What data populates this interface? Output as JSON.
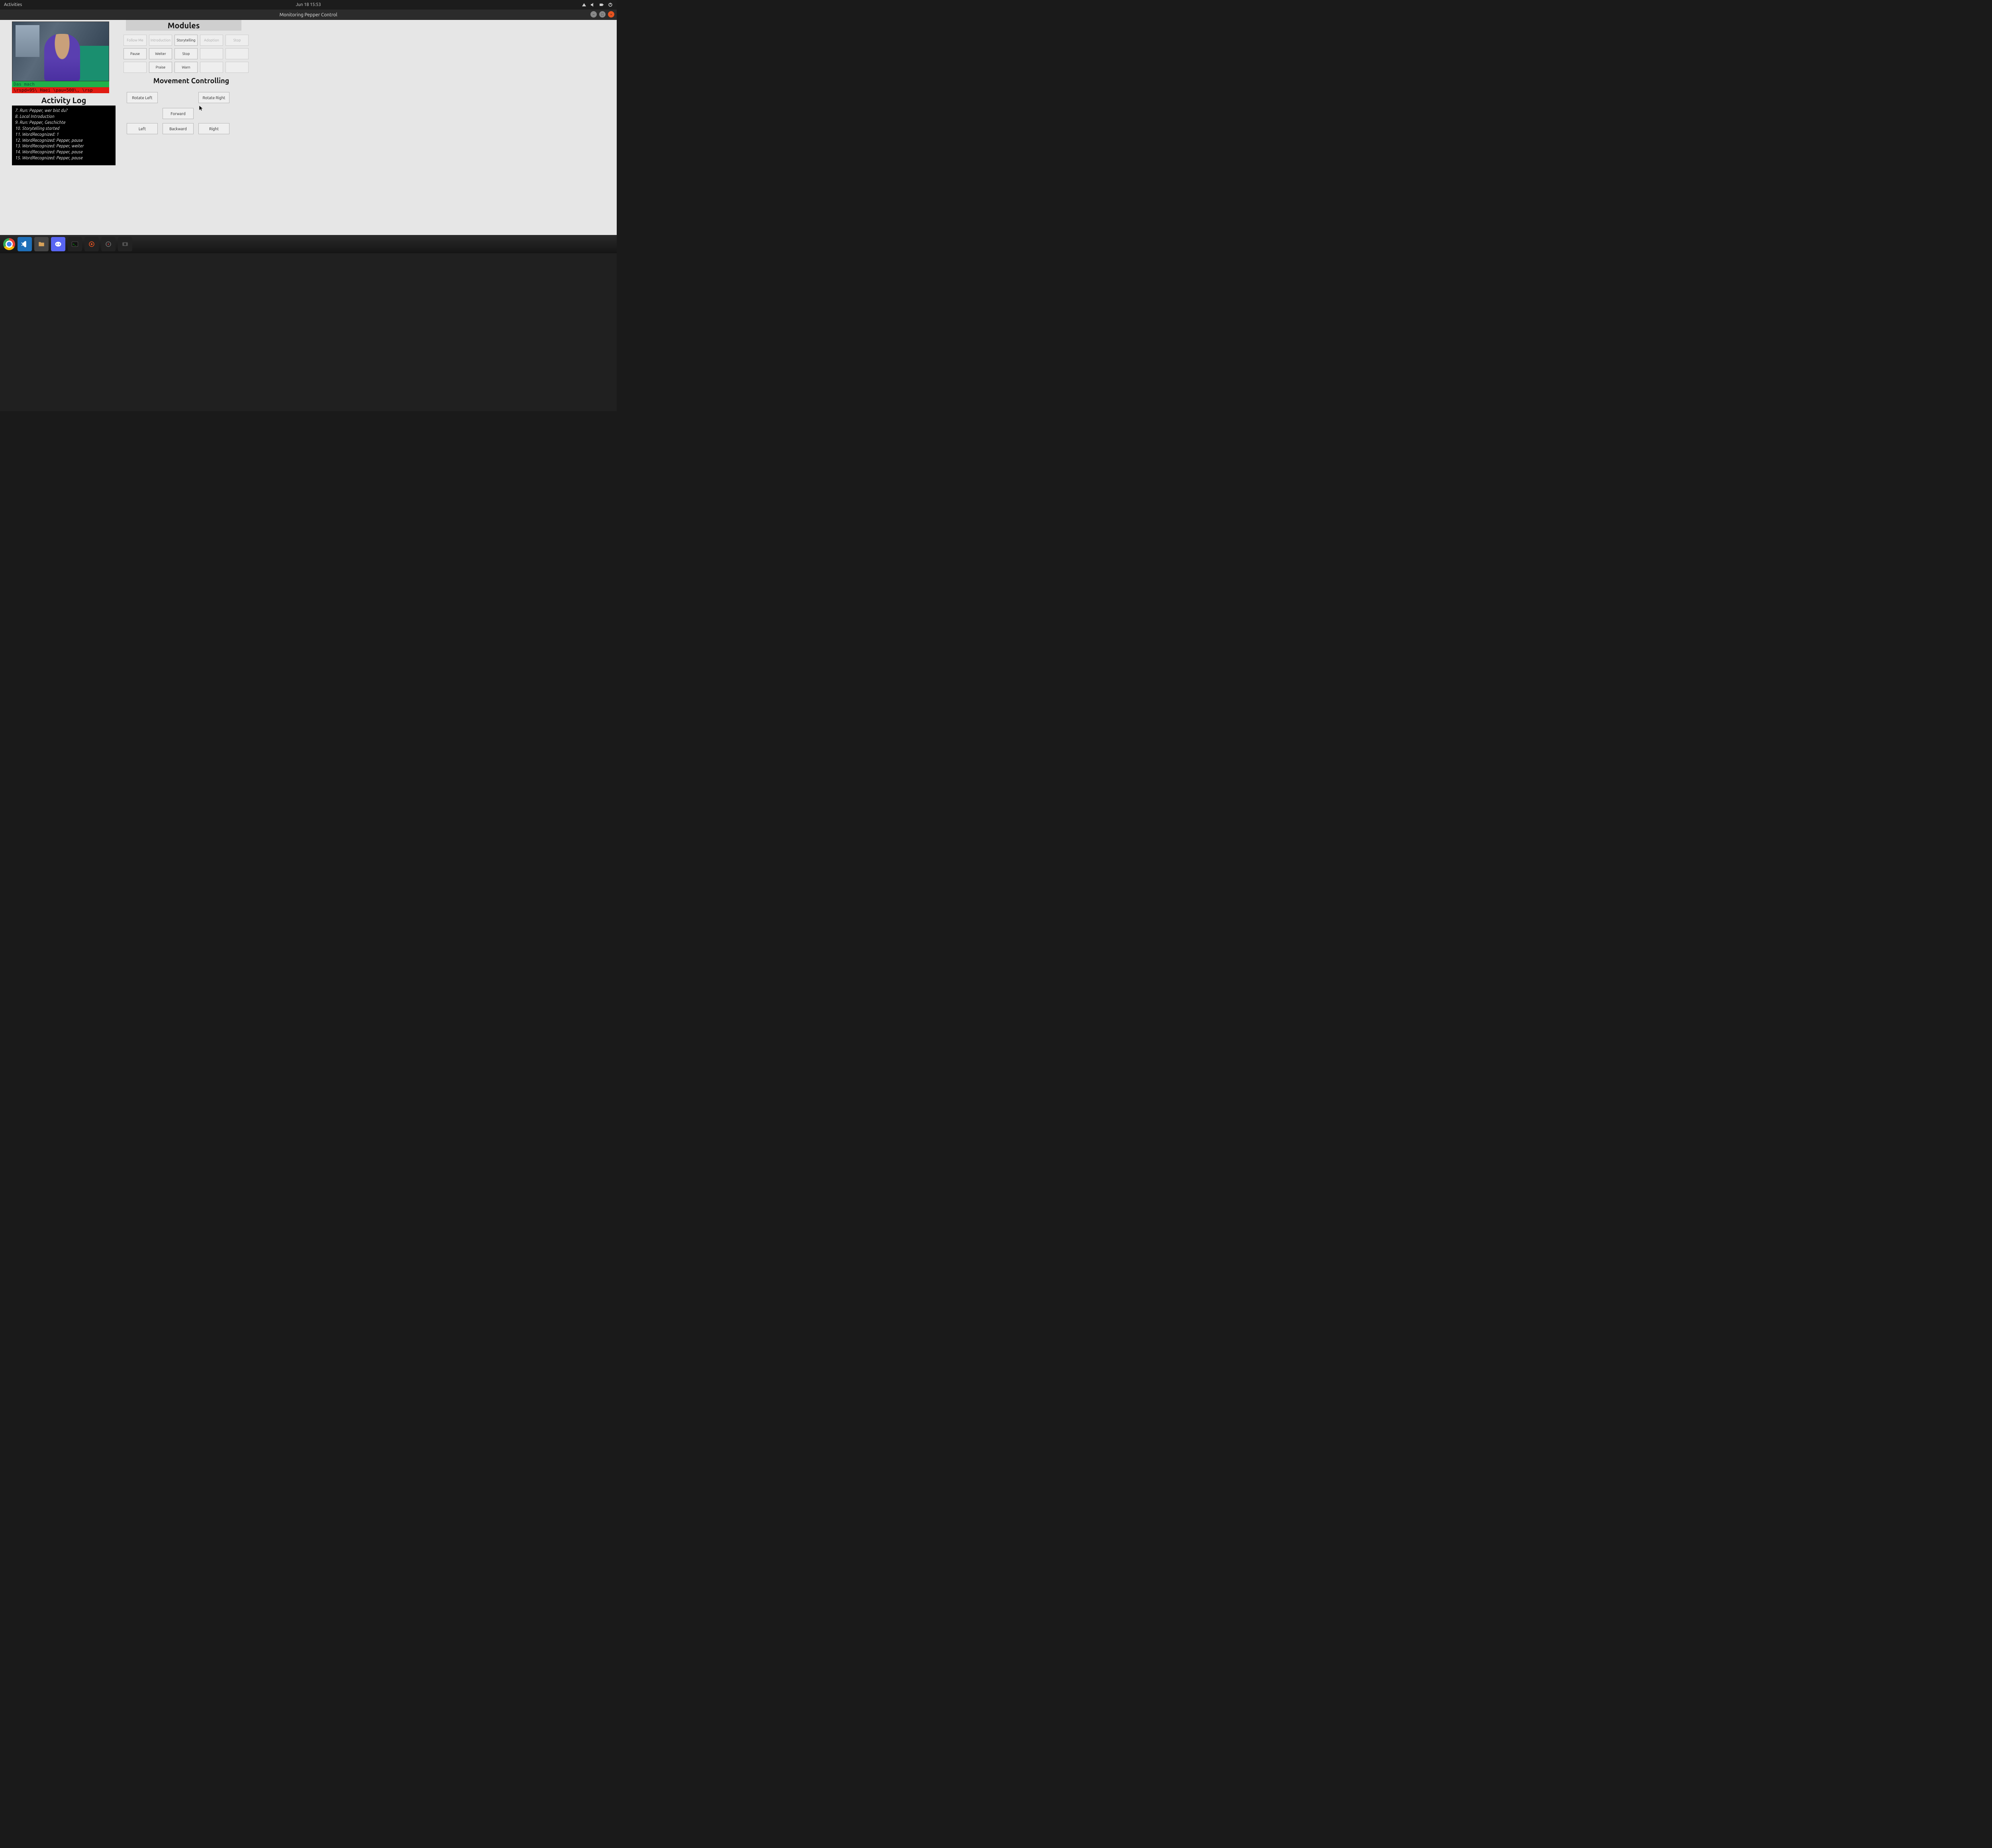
{
  "topbar": {
    "activities": "Activities",
    "datetime": "Jun 18  15:53"
  },
  "window": {
    "title": "Monitoring Pepper Control"
  },
  "status": {
    "line1": "Das mach",
    "line2": "\\rspd=95\\ Haei \\pau=500\\, \\rsp"
  },
  "activity": {
    "heading": "Activity Log",
    "entries": [
      "7. Run: Pepper, wer bist du?",
      "8. Local Introduction",
      "9. Run: Pepper, Geschichte",
      "10. Storytelling started",
      "11. WordRecognized: 1",
      "12. WordRecognized: Pepper, pause",
      "13. WordRecognized: Pepper, weiter",
      "14. WordRecognized: Pepper, pause",
      "15. WordRecognized: Pepper, pause"
    ]
  },
  "modules": {
    "heading": "Modules",
    "row1": [
      "Follow Me",
      "Introduction",
      "Storytelling",
      "Adoption",
      "Stop"
    ],
    "row1_disabled": [
      true,
      true,
      false,
      true,
      true
    ],
    "row2": [
      "Pause",
      "Weiter",
      "Stop",
      "",
      ""
    ],
    "row3": [
      "",
      "Praise",
      "Warn",
      "",
      ""
    ]
  },
  "movement": {
    "heading": "Movement Controlling",
    "rotate_left": "Rotate Left",
    "rotate_right": "Rotate Right",
    "forward": "Forward",
    "left": "Left",
    "backward": "Backward",
    "right": "Right"
  }
}
